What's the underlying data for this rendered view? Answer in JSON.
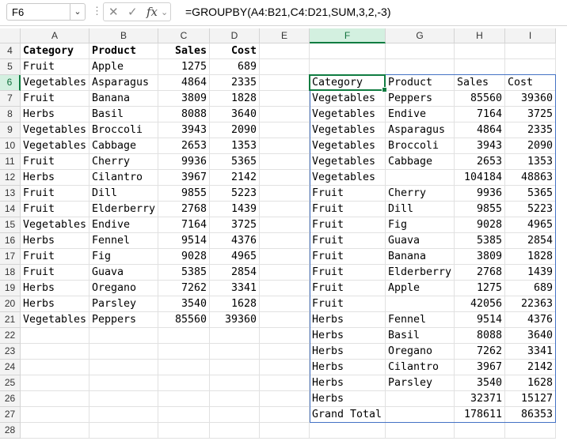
{
  "formula_bar": {
    "name_box": "F6",
    "cancel_icon": "✕",
    "enter_icon": "✓",
    "fx_label": "fx",
    "formula": "=GROUPBY(A4:B21,C4:D21,SUM,3,2,-3)"
  },
  "columns": [
    "A",
    "B",
    "C",
    "D",
    "E",
    "F",
    "G",
    "H",
    "I"
  ],
  "rows": [
    "4",
    "5",
    "6",
    "7",
    "8",
    "9",
    "10",
    "11",
    "12",
    "13",
    "14",
    "15",
    "16",
    "17",
    "18",
    "19",
    "20",
    "21",
    "22",
    "23",
    "24",
    "25",
    "26",
    "27",
    "28"
  ],
  "selected_column": "F",
  "selected_row": "6",
  "source_table": {
    "headers": [
      "Category",
      "Product",
      "Sales",
      "Cost"
    ],
    "rows": [
      [
        "Fruit",
        "Apple",
        "1275",
        "689"
      ],
      [
        "Vegetables",
        "Asparagus",
        "4864",
        "2335"
      ],
      [
        "Fruit",
        "Banana",
        "3809",
        "1828"
      ],
      [
        "Herbs",
        "Basil",
        "8088",
        "3640"
      ],
      [
        "Vegetables",
        "Broccoli",
        "3943",
        "2090"
      ],
      [
        "Vegetables",
        "Cabbage",
        "2653",
        "1353"
      ],
      [
        "Fruit",
        "Cherry",
        "9936",
        "5365"
      ],
      [
        "Herbs",
        "Cilantro",
        "3967",
        "2142"
      ],
      [
        "Fruit",
        "Dill",
        "9855",
        "5223"
      ],
      [
        "Fruit",
        "Elderberry",
        "2768",
        "1439"
      ],
      [
        "Vegetables",
        "Endive",
        "7164",
        "3725"
      ],
      [
        "Herbs",
        "Fennel",
        "9514",
        "4376"
      ],
      [
        "Fruit",
        "Fig",
        "9028",
        "4965"
      ],
      [
        "Fruit",
        "Guava",
        "5385",
        "2854"
      ],
      [
        "Herbs",
        "Oregano",
        "7262",
        "3341"
      ],
      [
        "Herbs",
        "Parsley",
        "3540",
        "1628"
      ],
      [
        "Vegetables",
        "Peppers",
        "85560",
        "39360"
      ]
    ]
  },
  "result_table": {
    "headers": [
      "Category",
      "Product",
      "Sales",
      "Cost"
    ],
    "rows": [
      [
        "Vegetables",
        "Peppers",
        "85560",
        "39360"
      ],
      [
        "Vegetables",
        "Endive",
        "7164",
        "3725"
      ],
      [
        "Vegetables",
        "Asparagus",
        "4864",
        "2335"
      ],
      [
        "Vegetables",
        "Broccoli",
        "3943",
        "2090"
      ],
      [
        "Vegetables",
        "Cabbage",
        "2653",
        "1353"
      ],
      [
        "Vegetables",
        "",
        "104184",
        "48863"
      ],
      [
        "Fruit",
        "Cherry",
        "9936",
        "5365"
      ],
      [
        "Fruit",
        "Dill",
        "9855",
        "5223"
      ],
      [
        "Fruit",
        "Fig",
        "9028",
        "4965"
      ],
      [
        "Fruit",
        "Guava",
        "5385",
        "2854"
      ],
      [
        "Fruit",
        "Banana",
        "3809",
        "1828"
      ],
      [
        "Fruit",
        "Elderberry",
        "2768",
        "1439"
      ],
      [
        "Fruit",
        "Apple",
        "1275",
        "689"
      ],
      [
        "Fruit",
        "",
        "42056",
        "22363"
      ],
      [
        "Herbs",
        "Fennel",
        "9514",
        "4376"
      ],
      [
        "Herbs",
        "Basil",
        "8088",
        "3640"
      ],
      [
        "Herbs",
        "Oregano",
        "7262",
        "3341"
      ],
      [
        "Herbs",
        "Cilantro",
        "3967",
        "2142"
      ],
      [
        "Herbs",
        "Parsley",
        "3540",
        "1628"
      ],
      [
        "Herbs",
        "",
        "32371",
        "15127"
      ],
      [
        "Grand Total",
        "",
        "178611",
        "86353"
      ]
    ]
  }
}
